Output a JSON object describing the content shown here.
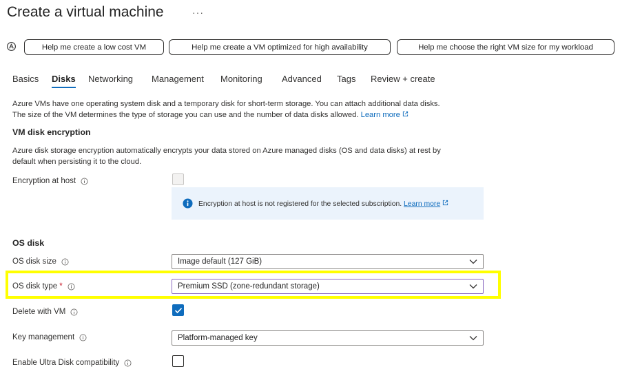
{
  "page": {
    "title": "Create a virtual machine",
    "more_label": "···"
  },
  "help_buttons": {
    "low_cost": "Help me create a low cost VM",
    "high_availability": "Help me create a VM optimized for high availability",
    "right_size": "Help me choose the right VM size for my workload"
  },
  "tabs": [
    {
      "label": "Basics",
      "active": false
    },
    {
      "label": "Disks",
      "active": true
    },
    {
      "label": "Networking",
      "active": false
    },
    {
      "label": "Management",
      "active": false
    },
    {
      "label": "Monitoring",
      "active": false
    },
    {
      "label": "Advanced",
      "active": false
    },
    {
      "label": "Tags",
      "active": false
    },
    {
      "label": "Review + create",
      "active": false
    }
  ],
  "intro": {
    "line1": "Azure VMs have one operating system disk and a temporary disk for short-term storage. You can attach additional data disks.",
    "line2": "The size of the VM determines the type of storage you can use and the number of data disks allowed.",
    "learn_more": "Learn more"
  },
  "encryption": {
    "heading": "VM disk encryption",
    "desc_line1": "Azure disk storage encryption automatically encrypts your data stored on Azure managed disks (OS and data disks) at rest by",
    "desc_line2": "default when persisting it to the cloud.",
    "host_label": "Encryption at host",
    "host_checked": false,
    "host_disabled": true,
    "info_message": "Encryption at host is not registered for the selected subscription.",
    "info_learn_more": "Learn more"
  },
  "os_disk": {
    "heading": "OS disk",
    "size_label": "OS disk size",
    "size_value": "Image default (127 GiB)",
    "type_label": "OS disk type",
    "type_required": "*",
    "type_value": "Premium SSD (zone-redundant storage)",
    "delete_label": "Delete with VM",
    "delete_checked": true,
    "key_label": "Key management",
    "key_value": "Platform-managed key",
    "ultra_label": "Enable Ultra Disk compatibility",
    "ultra_checked": false
  },
  "colors": {
    "accent": "#0f6cbd",
    "highlight": "#ffff00",
    "info_background": "#ebf3fc",
    "required": "#c50f1f"
  }
}
